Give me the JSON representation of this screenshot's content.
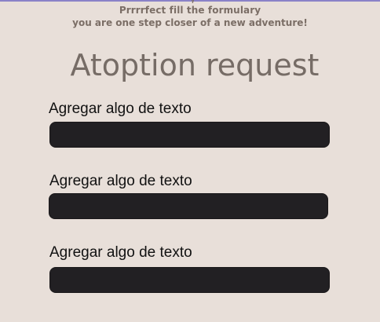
{
  "top_fragment": "y",
  "subtitle_line1": "Prrrrfect fill the formulary",
  "subtitle_line2": "you are one step closer of a new adventure!",
  "page_title": "Atoption request",
  "fields": [
    {
      "label": "Agregar algo de texto",
      "value": ""
    },
    {
      "label": "Agregar algo de texto",
      "value": ""
    },
    {
      "label": "Agregar algo de texto",
      "value": ""
    }
  ],
  "colors": {
    "background": "#e8dfd9",
    "field": "#222023",
    "title": "#766c66",
    "subtitle": "#7b6e66"
  }
}
